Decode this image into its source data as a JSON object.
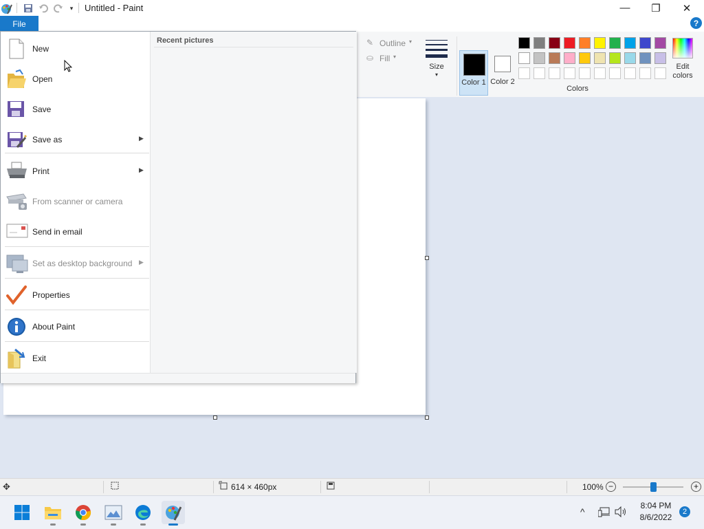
{
  "window": {
    "title": "Untitled - Paint",
    "minimize_glyph": "—",
    "maximize_glyph": "❐",
    "close_glyph": "✕"
  },
  "quick_access": {
    "icons": [
      "paint-app-icon",
      "save-icon",
      "undo-icon",
      "redo-icon",
      "customize-dropdown-icon"
    ]
  },
  "ribbon": {
    "file_tab": "File",
    "help_glyph": "?",
    "outline_label": "Outline",
    "fill_label": "Fill",
    "size_label": "Size",
    "color1_label": "Color 1",
    "color2_label": "Color 2",
    "edit_colors_label": "Edit colors",
    "colors_group_label": "Colors",
    "color1_value": "#000000",
    "color2_value": "#ffffff",
    "palette_row1": [
      "#000000",
      "#7f7f7f",
      "#880015",
      "#ed1c24",
      "#ff7f27",
      "#fff200",
      "#22b14c",
      "#00a2e8",
      "#3f48cc",
      "#a349a4"
    ],
    "palette_row2": [
      "#ffffff",
      "#c3c3c3",
      "#b97a57",
      "#ffaec9",
      "#ffc90e",
      "#efe4b0",
      "#b5e61d",
      "#99d9ea",
      "#7092be",
      "#c8bfe7"
    ]
  },
  "file_menu": {
    "items": [
      {
        "label": "New",
        "icon": "new-file-icon",
        "disabled": false,
        "submenu": false
      },
      {
        "label": "Open",
        "icon": "open-folder-icon",
        "disabled": false,
        "submenu": false
      },
      {
        "label": "Save",
        "icon": "save-disk-icon",
        "disabled": false,
        "submenu": false
      },
      {
        "label": "Save as",
        "icon": "save-as-icon",
        "disabled": false,
        "submenu": true
      },
      {
        "label": "Print",
        "icon": "printer-icon",
        "disabled": false,
        "submenu": true
      },
      {
        "label": "From scanner or camera",
        "icon": "scanner-icon",
        "disabled": true,
        "submenu": false
      },
      {
        "label": "Send in email",
        "icon": "email-icon",
        "disabled": false,
        "submenu": false
      },
      {
        "label": "Set as desktop background",
        "icon": "desktop-background-icon",
        "disabled": true,
        "submenu": true
      },
      {
        "label": "Properties",
        "icon": "checkmark-icon",
        "disabled": false,
        "submenu": false
      },
      {
        "label": "About Paint",
        "icon": "info-icon",
        "disabled": false,
        "submenu": false
      },
      {
        "label": "Exit",
        "icon": "exit-icon",
        "disabled": false,
        "submenu": false
      }
    ],
    "recent_title": "Recent pictures",
    "submenu_arrow": "▶"
  },
  "statusbar": {
    "canvas_size": "614 × 460px",
    "zoom": "100%",
    "zoom_out_glyph": "−",
    "zoom_in_glyph": "+",
    "zoom_fraction": 0.5
  },
  "taskbar": {
    "apps": [
      "windows-start-icon",
      "file-explorer-icon",
      "chrome-icon",
      "photos-icon",
      "edge-icon",
      "paint-icon"
    ],
    "time": "8:04 PM",
    "date": "8/6/2022",
    "notification_count": "2",
    "tray_chevron": "^"
  }
}
